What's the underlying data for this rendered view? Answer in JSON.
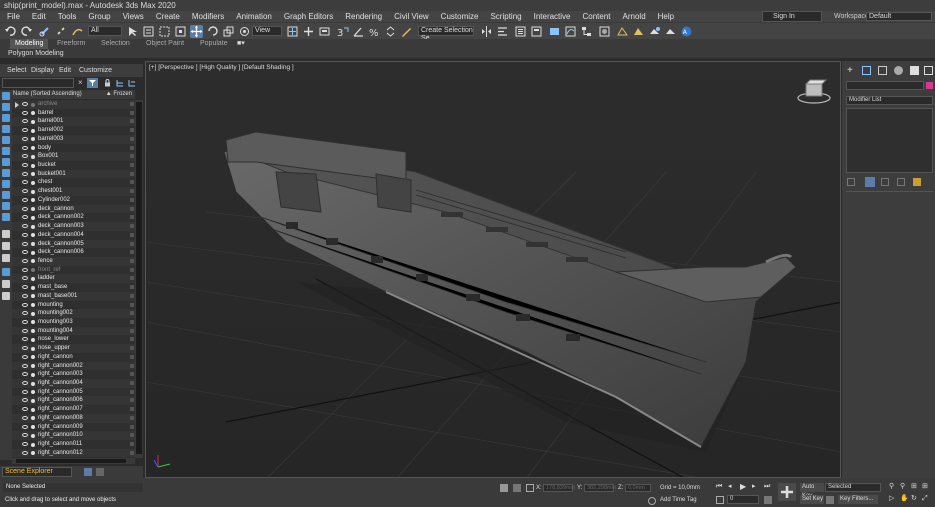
{
  "window": {
    "title": "ship(print_model).max - Autodesk 3ds Max 2020"
  },
  "menu": [
    "File",
    "Edit",
    "Tools",
    "Group",
    "Views",
    "Create",
    "Modifiers",
    "Animation",
    "Graph Editors",
    "Rendering",
    "Civil View",
    "Customize",
    "Scripting",
    "Interactive",
    "Content",
    "Arnold",
    "Help"
  ],
  "account": {
    "signin": "Sign In",
    "workspaces_label": "Workspaces:",
    "workspace": "Default"
  },
  "toolbar": {
    "filter": "All",
    "view": "View",
    "selection_set": "Create Selection Se"
  },
  "ribbon": {
    "tabs": [
      "Modeling",
      "Freeform",
      "Selection",
      "Object Paint",
      "Populate"
    ],
    "active_tab": "Modeling",
    "subpanel": "Polygon Modeling"
  },
  "scene_explorer": {
    "menu": [
      "Select",
      "Display",
      "Edit",
      "Customize"
    ],
    "column_name": "Name (Sorted Ascending)",
    "column_frozen": "▲ Frozen",
    "objects": [
      "archive",
      "barrel",
      "barrel001",
      "barrel002",
      "barrel003",
      "body",
      "Box001",
      "bucket",
      "bucket001",
      "chest",
      "chest001",
      "Cylinder002",
      "deck_cannon",
      "deck_cannon002",
      "deck_cannon003",
      "deck_cannon004",
      "deck_cannon005",
      "deck_cannon006",
      "fence",
      "front_ref",
      "ladder",
      "mast_base",
      "mast_base001",
      "mounting",
      "mounting002",
      "mounting003",
      "mounting004",
      "nose_lower",
      "nose_upper",
      "right_cannon",
      "right_cannon002",
      "right_cannon003",
      "right_cannon004",
      "right_cannon005",
      "right_cannon006",
      "right_cannon007",
      "right_cannon008",
      "right_cannon009",
      "right_cannon010",
      "right_cannon011",
      "right_cannon012"
    ],
    "dimmed": [
      "archive",
      "front_ref"
    ],
    "footer_label": "Scene Explorer"
  },
  "viewport": {
    "label": "[+] [Perspective ] [High Quality ] [Default Shading ]"
  },
  "command_panel": {
    "modifier_list": "Modifier List",
    "color": "#d63a8e"
  },
  "status": {
    "selection": "None Selected",
    "prompt": "Click and drag to select and move objects",
    "x_label": "X:",
    "x_value": "178,839mm",
    "y_label": "Y:",
    "y_value": "382,298mm",
    "z_label": "Z:",
    "z_value": "0,0mm",
    "grid": "Grid = 10,0mm",
    "add_time_tag": "Add Time Tag",
    "frame": "0",
    "auto_key": "Auto Key",
    "set_key": "Set Key",
    "key_mode": "Selected",
    "key_filters": "Key Filters..."
  }
}
